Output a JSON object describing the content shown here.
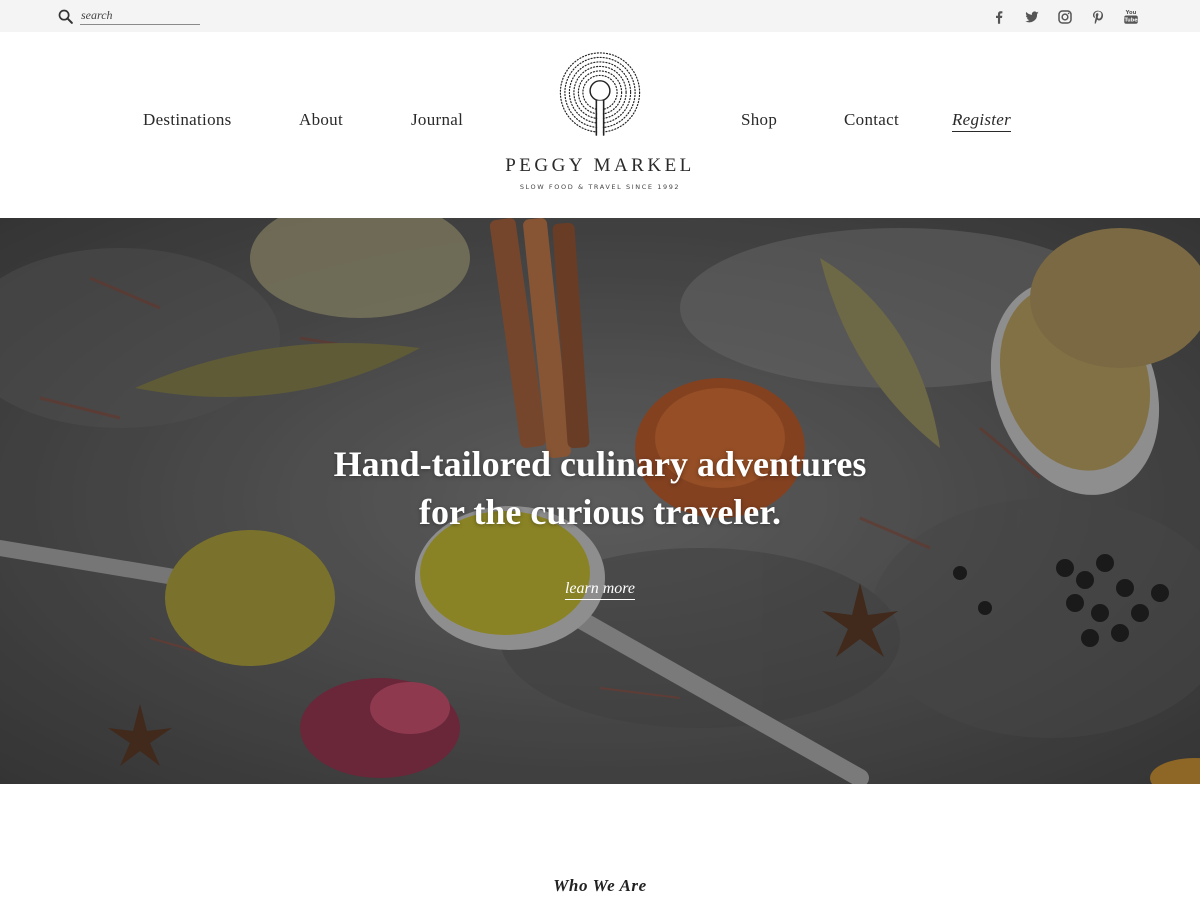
{
  "search": {
    "placeholder": "search"
  },
  "social": [
    {
      "icon": "facebook-icon"
    },
    {
      "icon": "twitter-icon"
    },
    {
      "icon": "instagram-icon"
    },
    {
      "icon": "pinterest-icon"
    },
    {
      "icon": "youtube-icon"
    }
  ],
  "nav": {
    "left": [
      "Destinations",
      "About",
      "Journal"
    ],
    "right": [
      "Shop",
      "Contact"
    ],
    "register": "Register"
  },
  "logo": {
    "brand": "PEGGY MARKEL",
    "tagline": "SLOW FOOD & TRAVEL SINCE 1992"
  },
  "hero": {
    "title_line1": "Hand-tailored culinary adventures",
    "title_line2": "for the curious traveler.",
    "cta": "learn more"
  },
  "section": {
    "heading": "Who We Are"
  },
  "colors": {
    "topbar_bg": "#f4f4f4",
    "text": "#2a2a2a",
    "hero_text": "#ffffff"
  }
}
